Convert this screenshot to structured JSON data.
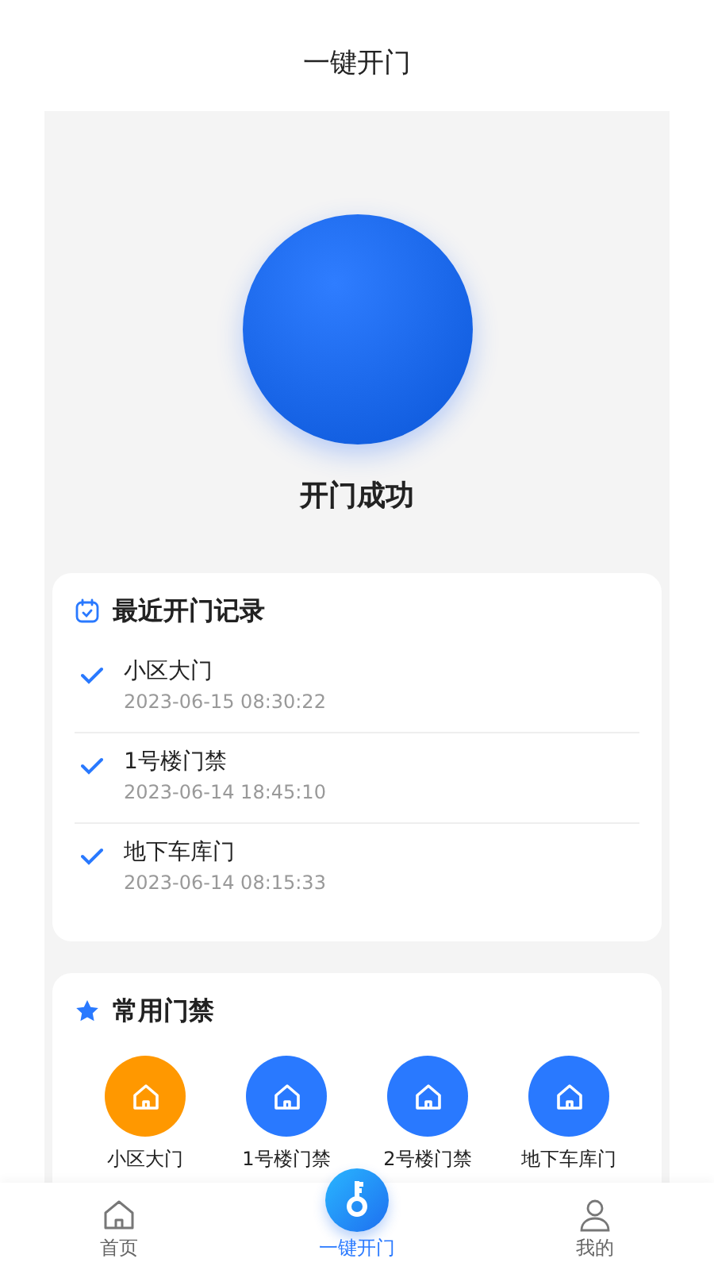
{
  "header": {
    "title": "一键开门"
  },
  "unlock": {
    "status": "开门成功"
  },
  "recent": {
    "title": "最近开门记录",
    "records": [
      {
        "name": "小区大门",
        "time": "2023-06-15 08:30:22"
      },
      {
        "name": "1号楼门禁",
        "time": "2023-06-14 18:45:10"
      },
      {
        "name": "地下车库门",
        "time": "2023-06-14 08:15:33"
      }
    ]
  },
  "favorites": {
    "title": "常用门禁",
    "doors": [
      {
        "name": "小区大门",
        "color": "#ff9800"
      },
      {
        "name": "1号楼门禁",
        "color": "#2979ff"
      },
      {
        "name": "2号楼门禁",
        "color": "#2979ff"
      },
      {
        "name": "地下车库门",
        "color": "#2979ff"
      }
    ]
  },
  "tabs": [
    {
      "label": "首页",
      "kind": "home",
      "selected": false
    },
    {
      "label": "一键开门",
      "kind": "key",
      "selected": true
    },
    {
      "label": "我的",
      "kind": "user",
      "selected": false
    }
  ]
}
